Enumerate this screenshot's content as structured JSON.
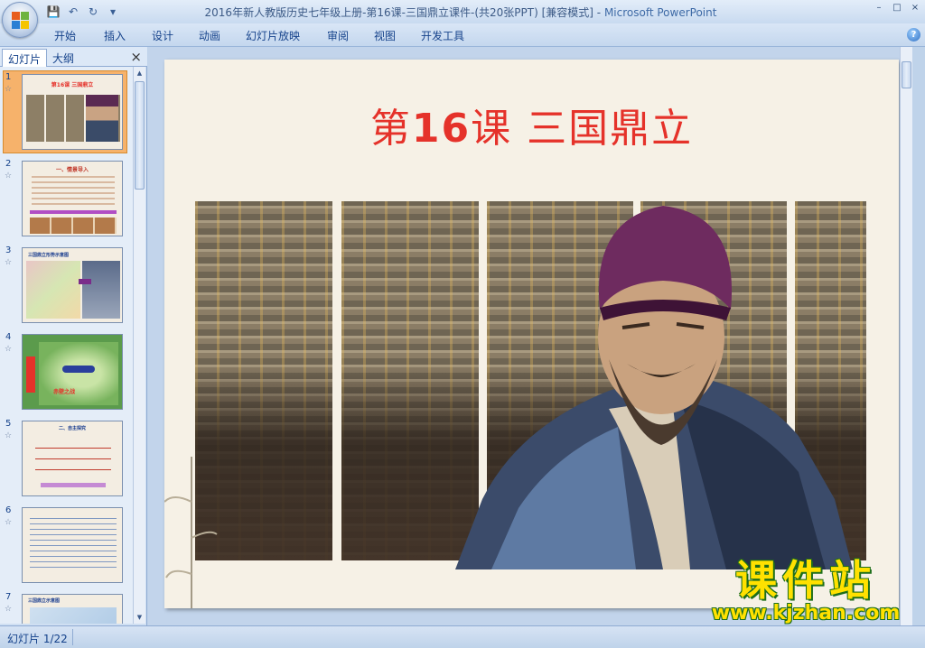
{
  "window": {
    "title": "2016年新人教版历史七年级上册-第16课-三国鼎立课件-(共20张PPT) [兼容模式]",
    "title_sep": "-",
    "app_name": "Microsoft PowerPoint",
    "controls": [
      "–",
      "□",
      "×"
    ]
  },
  "quick_access": {
    "save": "💾",
    "undo": "↶",
    "redo": "↻",
    "more": "▾"
  },
  "ribbon": {
    "tabs": [
      "开始",
      "插入",
      "设计",
      "动画",
      "幻灯片放映",
      "审阅",
      "视图",
      "开发工具"
    ],
    "help": "?"
  },
  "left_pane": {
    "tabs": [
      "幻灯片",
      "大纲"
    ],
    "close": "×",
    "slides": [
      {
        "num": "1",
        "title": "第16课  三国鼎立"
      },
      {
        "num": "2",
        "title": "一、情景导入"
      },
      {
        "num": "3",
        "title": "三国鼎立形势示意图"
      },
      {
        "num": "4",
        "title": "赤壁之战"
      },
      {
        "num": "5",
        "title": "二、自主探究"
      },
      {
        "num": "6",
        "title": ""
      },
      {
        "num": "7",
        "title": "三国鼎立示意图"
      }
    ],
    "star": "☆"
  },
  "slide": {
    "title_prefix": "第",
    "title_num": "16",
    "title_suffix": "课 三国鼎立"
  },
  "watermark": {
    "big": "课件站",
    "url": "www.kjzhan.com"
  },
  "status": {
    "slide_counter": "幻灯片 1/22"
  },
  "colors": {
    "title_red": "#e5322a",
    "watermark_yellow": "#ffe100",
    "watermark_green": "#1d6e1a"
  }
}
